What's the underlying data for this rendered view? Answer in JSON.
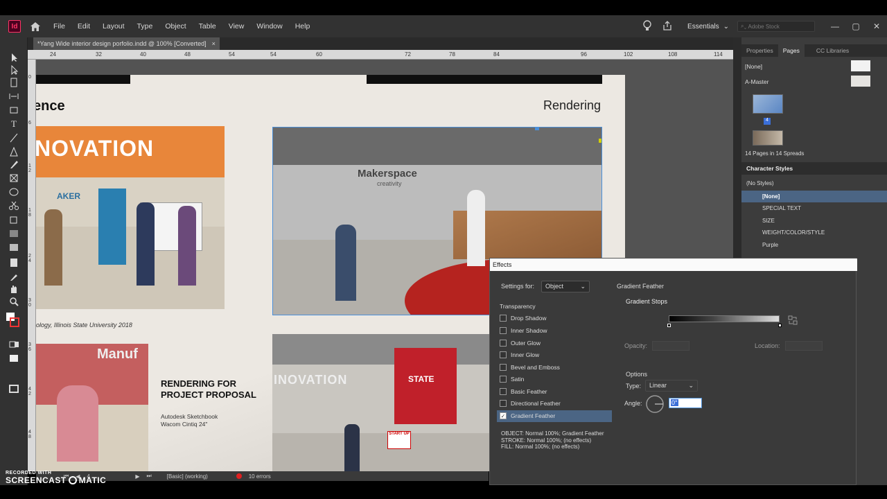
{
  "app": {
    "logo": "Id",
    "home_icon": "home-icon"
  },
  "menu": [
    "File",
    "Edit",
    "Layout",
    "Type",
    "Object",
    "Table",
    "View",
    "Window",
    "Help"
  ],
  "topbar": {
    "workspace": "Essentials",
    "search_placeholder": "Adobe Stock"
  },
  "document": {
    "tab_title": "*Yang Wide interior design porfolio.indd @ 100% [Converted]",
    "close": "×"
  },
  "ruler_h": [
    "24",
    "32",
    "40",
    "48",
    "54",
    "60",
    "72",
    "78",
    "84",
    "96",
    "102",
    "108",
    "114"
  ],
  "ruler_v": [
    "0",
    "6",
    "1 2",
    "1 8",
    "2 4",
    "3 0",
    "3 6",
    "4 2",
    "4 8"
  ],
  "page": {
    "heading_fragment": "ence",
    "right_title": "Rendering",
    "caption_left": "ology, Illinois State University 2018",
    "project_title": "RENDERING FOR PROJECT PROPOSAL",
    "project_tools": [
      "Autodesk Sketchbook",
      "Wacom Cintiq 24\""
    ],
    "image_text": {
      "inovation": "NOVATION",
      "maker": "AKER",
      "makerspace": "Makerspace",
      "creativity": "creativity",
      "manuf": "Manuf",
      "inovation2": "INOVATION",
      "state": "STATE",
      "startup": "START UP"
    }
  },
  "status": {
    "page": "4",
    "style": "[Basic] (working)",
    "errors": "10 errors"
  },
  "watermark": {
    "recorded": "RECORDED WITH",
    "brand": "SCREENCAST",
    "brand2": "MATIC"
  },
  "panels": {
    "tabs": [
      "Properties",
      "Pages",
      "CC Libraries"
    ],
    "pages": {
      "none": "[None]",
      "master": "A-Master",
      "page_num": "4",
      "summary": "14 Pages in 14 Spreads"
    },
    "character_styles": {
      "title": "Character Styles",
      "current": "(No Styles)",
      "items": [
        "[None]",
        "SPECIAL TEXT",
        "SIZE",
        "WEIGHT/COLOR/STYLE",
        "Purple"
      ]
    }
  },
  "effects": {
    "title": "Effects",
    "settings_label": "Settings for:",
    "settings_value": "Object",
    "section": "Transparency",
    "effects_list": [
      {
        "label": "Drop Shadow",
        "checked": false
      },
      {
        "label": "Inner Shadow",
        "checked": false
      },
      {
        "label": "Outer Glow",
        "checked": false
      },
      {
        "label": "Inner Glow",
        "checked": false
      },
      {
        "label": "Bevel and Emboss",
        "checked": false
      },
      {
        "label": "Satin",
        "checked": false
      },
      {
        "label": "Basic Feather",
        "checked": false
      },
      {
        "label": "Directional Feather",
        "checked": false
      },
      {
        "label": "Gradient Feather",
        "checked": true
      }
    ],
    "summary": "OBJECT: Normal 100%; Gradient Feather\nSTROKE: Normal 100%; (no effects)\nFILL: Normal 100%; (no effects)",
    "panel_title": "Gradient Feather",
    "stops_label": "Gradient Stops",
    "opacity_label": "Opacity:",
    "location_label": "Location:",
    "options_label": "Options",
    "type_label": "Type:",
    "type_value": "Linear",
    "angle_label": "Angle:",
    "angle_value": "0°",
    "colors": {
      "accent": "#4b6584",
      "cursor_ring": "#f0e33a"
    }
  }
}
